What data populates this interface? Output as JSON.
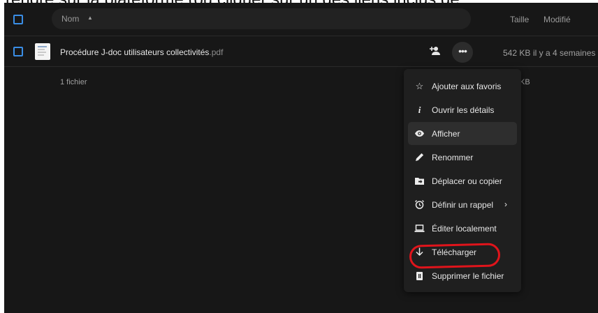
{
  "caption": "rendre sur la plateforme (ou cliquer sur un des liens inclus de",
  "header": {
    "name_label": "Nom",
    "size_label": "Taille",
    "modified_label": "Modifié"
  },
  "file": {
    "name": "Procédure J-doc utilisateurs collectivités",
    "extension": ".pdf",
    "size": "542 KB",
    "modified": "il y a 4 semaines"
  },
  "summary": {
    "count": "1 fichier",
    "size": "KB"
  },
  "menu": {
    "items": [
      {
        "label": "Ajouter aux favoris",
        "icon": "star-icon"
      },
      {
        "label": "Ouvrir les détails",
        "icon": "info-icon"
      },
      {
        "label": "Afficher",
        "icon": "eye-icon"
      },
      {
        "label": "Renommer",
        "icon": "pencil-icon"
      },
      {
        "label": "Déplacer ou copier",
        "icon": "folder-move-icon"
      },
      {
        "label": "Définir un rappel",
        "icon": "alarm-icon"
      },
      {
        "label": "Éditer localement",
        "icon": "laptop-icon"
      },
      {
        "label": "Télécharger",
        "icon": "download-icon"
      },
      {
        "label": "Supprimer le fichier",
        "icon": "trash-icon"
      }
    ]
  },
  "colors": {
    "accent": "#3a8ee6",
    "background": "#171717",
    "menu_background": "#1f1f1f",
    "annotation": "#e0141b"
  }
}
